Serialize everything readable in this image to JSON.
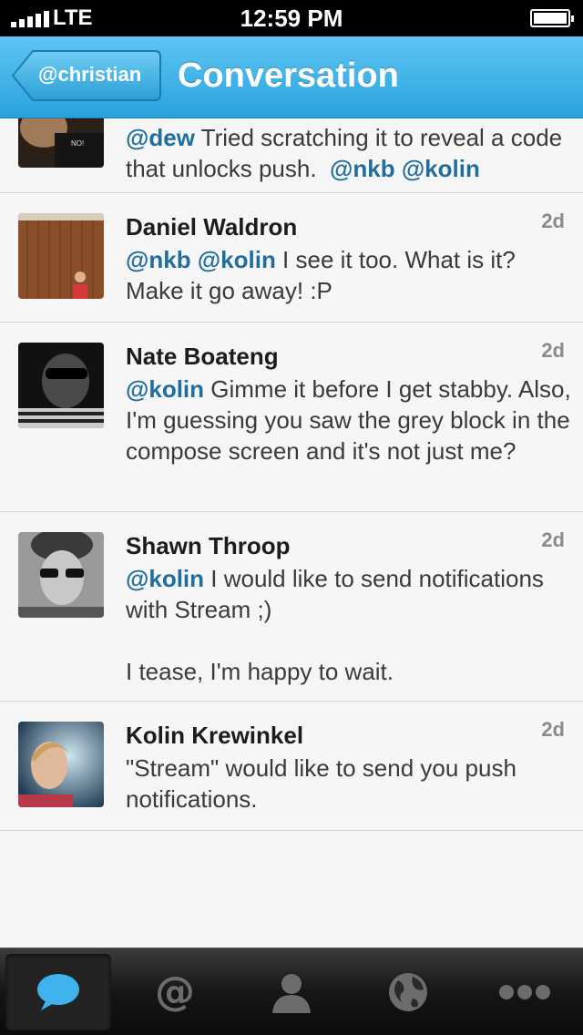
{
  "status_bar": {
    "carrier": "LTE",
    "time": "12:59 PM"
  },
  "nav": {
    "back_label": "@christian",
    "title": "Conversation"
  },
  "tweets": [
    {
      "name": "",
      "age": "",
      "avatar_icon": "user-avatar-photo",
      "mention_lead": "@dew",
      "text": " Tried scratching it to reveal a code that unlocks push.",
      "mention_tail": "@nkb @kolin"
    },
    {
      "name": "Daniel Waldron",
      "age": "2d",
      "avatar_icon": "user-avatar-photo",
      "mention_lead": "@nkb @kolin",
      "text": " I see it too. What is it? Make it go away! :P"
    },
    {
      "name": "Nate Boateng",
      "age": "2d",
      "avatar_icon": "user-avatar-photo",
      "mention_lead": "@kolin",
      "text": " Gimme it before I get stabby. Also, I'm guessing you saw the grey block in the compose screen and it's not just me?"
    },
    {
      "name": "Shawn Throop",
      "age": "2d",
      "avatar_icon": "user-avatar-photo",
      "mention_lead": "@kolin",
      "text": " I would like to send notifications with Stream ;)",
      "extra": "I tease, I'm happy to wait."
    },
    {
      "name": "Kolin Krewinkel",
      "age": "2d",
      "avatar_icon": "user-avatar-photo",
      "text": "\"Stream\" would like to send you push notifications."
    }
  ],
  "tabs": [
    {
      "icon": "conversation-bubble-icon",
      "active": true
    },
    {
      "icon": "at-mention-icon",
      "active": false
    },
    {
      "icon": "person-icon",
      "active": false
    },
    {
      "icon": "globe-icon",
      "active": false
    },
    {
      "icon": "more-dots-icon",
      "active": false
    }
  ],
  "colors": {
    "nav_blue": "#2aa2dd",
    "mention_blue": "#1f6e9e",
    "tab_active_icon": "#3fb3ee"
  }
}
